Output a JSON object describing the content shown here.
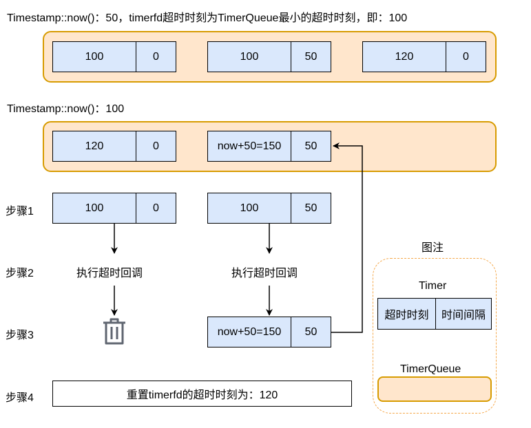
{
  "state1": {
    "title": "Timestamp::now()：50，timerfd超时时刻为TimerQueue最小的超时时刻，即：100",
    "timers": [
      {
        "expiration": "100",
        "interval": "0"
      },
      {
        "expiration": "100",
        "interval": "50"
      },
      {
        "expiration": "120",
        "interval": "0"
      }
    ]
  },
  "state2": {
    "title": "Timestamp::now()：100",
    "timers": [
      {
        "expiration": "120",
        "interval": "0"
      },
      {
        "expiration": "now+50=150",
        "interval": "50"
      }
    ]
  },
  "steps": {
    "step1": {
      "label": "步骤1",
      "timers": [
        {
          "expiration": "100",
          "interval": "0"
        },
        {
          "expiration": "100",
          "interval": "50"
        }
      ]
    },
    "step2": {
      "label": "步骤2",
      "actions": [
        "执行超时回调",
        "执行超时回调"
      ]
    },
    "step3": {
      "label": "步骤3",
      "timer": {
        "expiration": "now+50=150",
        "interval": "50"
      }
    },
    "step4": {
      "label": "步骤4",
      "text": "重置timerfd的超时时刻为：120"
    }
  },
  "legend": {
    "title": "图注",
    "timer_label": "Timer",
    "timer_fields": [
      "超时时刻",
      "时间间隔"
    ],
    "queue_label": "TimerQueue"
  },
  "icons": {
    "delete": "trash-icon"
  },
  "colors": {
    "queue_fill": "#ffe6cc",
    "queue_border": "#d79b00",
    "timer_fill": "#dae8fc",
    "legend_border": "#f5a84a"
  }
}
